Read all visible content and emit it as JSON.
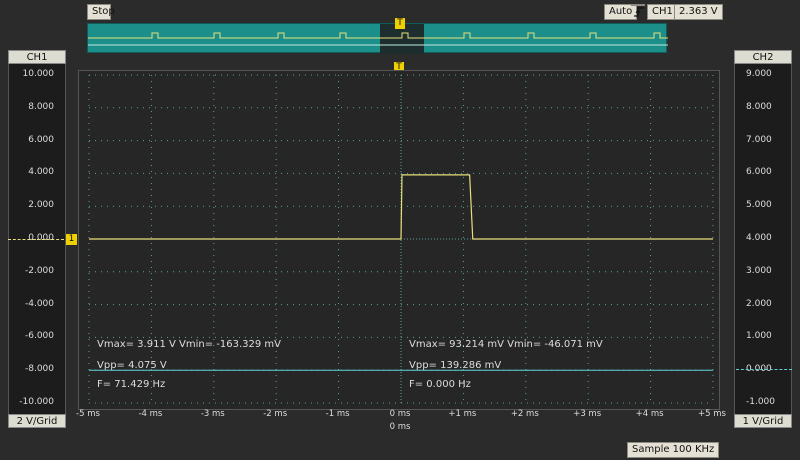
{
  "toolbar": {
    "stop_label": "Stop",
    "auto_label": "Auto",
    "trigger_edge_icon": "rising-edge-icon",
    "trigger_source": "CH1",
    "trigger_level": "2.363 V"
  },
  "markers": {
    "trigger": "T"
  },
  "ch1": {
    "header": "CH1",
    "ticks": [
      "10.000",
      "8.000",
      "6.000",
      "4.000",
      "2.000",
      "0.000",
      "-2.000",
      "-4.000",
      "-6.000",
      "-8.000",
      "-10.000"
    ],
    "scale_label": "2 V/Grid",
    "color": "#e8e07a",
    "marker_label": "1",
    "meas": {
      "line1": "Vmax= 3.911 V  Vmin= -163.329 mV",
      "line2": "Vpp= 4.075 V",
      "line3": "F= 71.429 Hz"
    }
  },
  "ch2": {
    "header": "CH2",
    "ticks": [
      "9.000",
      "8.000",
      "7.000",
      "6.000",
      "5.000",
      "4.000",
      "3.000",
      "2.000",
      "1.000",
      "0.000",
      "-1.000"
    ],
    "scale_label": "1 V/Grid",
    "color": "#5fd0d8",
    "meas": {
      "line1": "Vmax= 93.214 mV  Vmin= -46.071 mV",
      "line2": "Vpp= 139.286 mV",
      "line3": "F= 0.000 Hz"
    }
  },
  "time_axis": {
    "labels": [
      "-5 ms",
      "-4 ms",
      "-3 ms",
      "-2 ms",
      "-1 ms",
      "0 ms",
      "+1 ms",
      "+2 ms",
      "+3 ms",
      "+4 ms",
      "+5 ms"
    ],
    "center_label": "0 ms"
  },
  "status": {
    "sample_rate": "Sample 100 KHz"
  }
}
